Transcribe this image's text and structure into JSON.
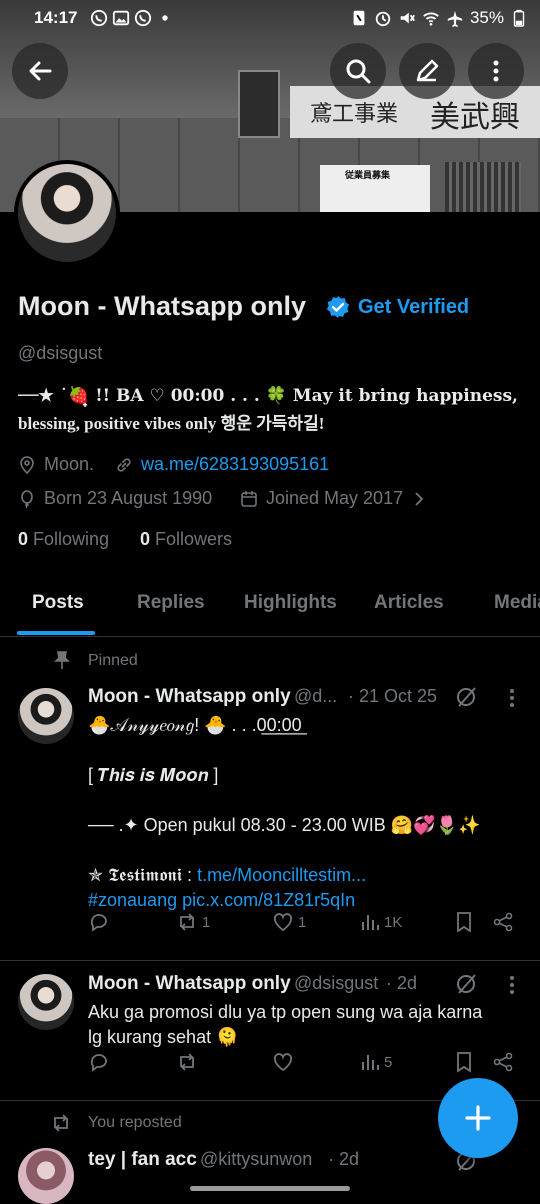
{
  "status_bar": {
    "time": "14:17",
    "battery": "35%",
    "icons": [
      "whatsapp-icon",
      "gallery-icon",
      "whatsapp-icon",
      "dot-icon",
      "nfc-icon",
      "alarm-icon",
      "mute-icon",
      "wifi-icon",
      "airplane-icon",
      "battery-icon"
    ]
  },
  "banner": {
    "sign_text_1": "鳶工事業",
    "sign_text_2": "美武興",
    "board_text": "従業員募集"
  },
  "profile": {
    "name": "Moon - Whatsapp only",
    "get_verified": "Get Verified",
    "handle": "@dsisgust",
    "bio_line1": "──★ ˙🍓̟ !! BA ♡  00:00 . . . 🍀 May it bring happiness,",
    "bio_line2": "blessing, positive vibes only 행운 가득하길!",
    "location": "Moon.",
    "website": "wa.me/6283193095161",
    "birthday": "Born 23 August 1990",
    "joined": "Joined May 2017",
    "following_count": "0",
    "following_label": "Following",
    "followers_count": "0",
    "followers_label": "Followers"
  },
  "tabs": [
    "Posts",
    "Replies",
    "Highlights",
    "Articles",
    "Media"
  ],
  "active_tab": "Posts",
  "posts": [
    {
      "pinned_label": "Pinned",
      "name": "Moon - Whatsapp only",
      "handle": "@d...",
      "date": "· 21 Oct 25",
      "line1": "🐣𝒜𝓃𝓎𝓎𝑒𝑜𝓃𝑔! 🐣 . . .0̲0̲:̲0̲0̲",
      "line2": "[ 𝑻𝒉𝒊𝒔 𝒊𝒔 𝑴𝒐𝒐𝒏 ]",
      "line3": "── .✦ Open pukul 08.30 - 23.00 WIB 🤗💞🌷✨",
      "line4_prefix": "✯ 𝕿𝖊𝖘𝖙𝖎𝖒𝖔𝖓𝖎 : ",
      "line4_link": "t.me/Mooncilltestim...",
      "line5": "#zonauang pic.x.com/81Z81r5qIn",
      "replies": "",
      "reposts": "1",
      "likes": "1",
      "views": "1K"
    },
    {
      "name": "Moon - Whatsapp only",
      "handle": "@dsisgust",
      "date": "· 2d",
      "line1": "Aku ga promosi dlu ya tp open sung wa aja karna",
      "line2": "lg kurang sehat 🫠",
      "replies": "",
      "reposts": "",
      "likes": "",
      "views": "5"
    },
    {
      "repost_label": "You reposted",
      "name": "tey | fan acc",
      "handle": "@kittysunwon",
      "date": "· 2d"
    }
  ]
}
